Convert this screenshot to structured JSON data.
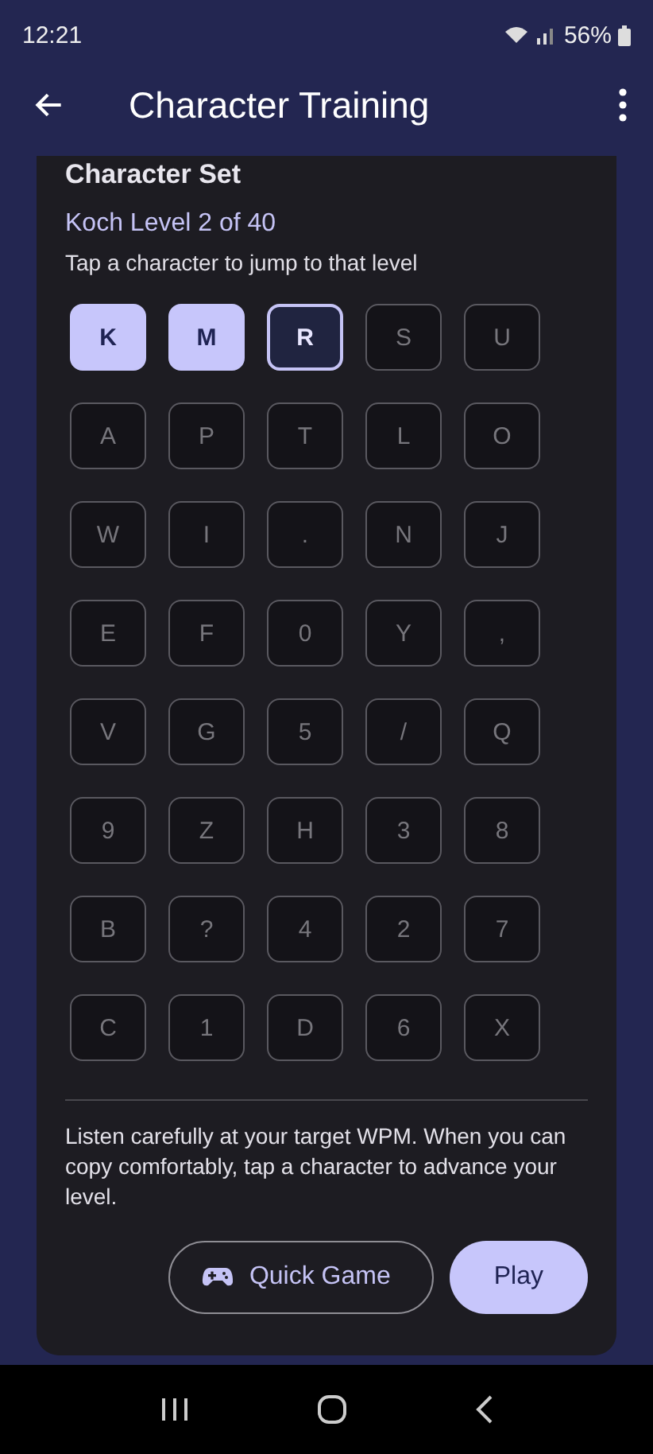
{
  "status_bar": {
    "time": "12:21",
    "battery": "56%"
  },
  "app_bar": {
    "title": "Character Training"
  },
  "card": {
    "title": "Character Set",
    "level": "Koch Level 2 of 40",
    "hint": "Tap a character to jump to that level",
    "characters": [
      {
        "label": "K",
        "learned": true,
        "selected": false
      },
      {
        "label": "M",
        "learned": true,
        "selected": false
      },
      {
        "label": "R",
        "learned": false,
        "selected": true
      },
      {
        "label": "S",
        "learned": false,
        "selected": false
      },
      {
        "label": "U",
        "learned": false,
        "selected": false
      },
      {
        "label": "A",
        "learned": false,
        "selected": false
      },
      {
        "label": "P",
        "learned": false,
        "selected": false
      },
      {
        "label": "T",
        "learned": false,
        "selected": false
      },
      {
        "label": "L",
        "learned": false,
        "selected": false
      },
      {
        "label": "O",
        "learned": false,
        "selected": false
      },
      {
        "label": "W",
        "learned": false,
        "selected": false
      },
      {
        "label": "I",
        "learned": false,
        "selected": false
      },
      {
        "label": ".",
        "learned": false,
        "selected": false
      },
      {
        "label": "N",
        "learned": false,
        "selected": false
      },
      {
        "label": "J",
        "learned": false,
        "selected": false
      },
      {
        "label": "E",
        "learned": false,
        "selected": false
      },
      {
        "label": "F",
        "learned": false,
        "selected": false
      },
      {
        "label": "0",
        "learned": false,
        "selected": false
      },
      {
        "label": "Y",
        "learned": false,
        "selected": false
      },
      {
        "label": ",",
        "learned": false,
        "selected": false
      },
      {
        "label": "V",
        "learned": false,
        "selected": false
      },
      {
        "label": "G",
        "learned": false,
        "selected": false
      },
      {
        "label": "5",
        "learned": false,
        "selected": false
      },
      {
        "label": "/",
        "learned": false,
        "selected": false
      },
      {
        "label": "Q",
        "learned": false,
        "selected": false
      },
      {
        "label": "9",
        "learned": false,
        "selected": false
      },
      {
        "label": "Z",
        "learned": false,
        "selected": false
      },
      {
        "label": "H",
        "learned": false,
        "selected": false
      },
      {
        "label": "3",
        "learned": false,
        "selected": false
      },
      {
        "label": "8",
        "learned": false,
        "selected": false
      },
      {
        "label": "B",
        "learned": false,
        "selected": false
      },
      {
        "label": "?",
        "learned": false,
        "selected": false
      },
      {
        "label": "4",
        "learned": false,
        "selected": false
      },
      {
        "label": "2",
        "learned": false,
        "selected": false
      },
      {
        "label": "7",
        "learned": false,
        "selected": false
      },
      {
        "label": "C",
        "learned": false,
        "selected": false
      },
      {
        "label": "1",
        "learned": false,
        "selected": false
      },
      {
        "label": "D",
        "learned": false,
        "selected": false
      },
      {
        "label": "6",
        "learned": false,
        "selected": false
      },
      {
        "label": "X",
        "learned": false,
        "selected": false
      }
    ],
    "note": "Listen carefully at your target WPM. When you can copy comfortably, tap a character to advance your level.",
    "buttons": [
      {
        "label": "Quick Game",
        "kind": "outlined"
      },
      {
        "label": "Play",
        "kind": "filled"
      }
    ]
  }
}
